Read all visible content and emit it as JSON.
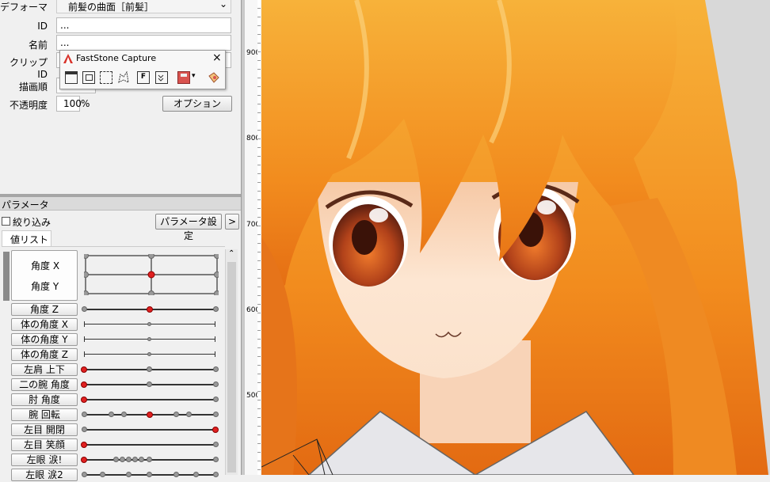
{
  "deformer": {
    "label": "デフォーマ",
    "value": "前髪の曲面［前髪］"
  },
  "id_field": {
    "label": "ID",
    "value": "..."
  },
  "name_field": {
    "label": "名前",
    "value": "..."
  },
  "clip_field": {
    "label": "クリップID"
  },
  "draw_order": {
    "label": "描画順"
  },
  "opacity": {
    "label": "不透明度",
    "value": "100",
    "unit": "%"
  },
  "option_button": "オプション",
  "faststone": {
    "title": "FastStone Capture",
    "close": "×"
  },
  "param_panel": {
    "title": "パラメータ",
    "filter_label": "絞り込み",
    "settings_button": "パラメータ設定",
    "more_button": ">",
    "tab": "値リスト"
  },
  "params": [
    {
      "label": "角度 X"
    },
    {
      "label": "角度 Y"
    },
    {
      "label": "角度 Z"
    },
    {
      "label": "体の角度 X"
    },
    {
      "label": "体の角度 Y"
    },
    {
      "label": "体の角度 Z"
    },
    {
      "label": "左肩 上下"
    },
    {
      "label": "二の腕 角度"
    },
    {
      "label": "肘 角度"
    },
    {
      "label": "腕 回転"
    },
    {
      "label": "左目 開閉"
    },
    {
      "label": "左目 笑顔"
    },
    {
      "label": "左眼 涙!"
    },
    {
      "label": "左眼 涙2"
    }
  ],
  "ruler": [
    "900",
    "800",
    "700",
    "600",
    "500"
  ],
  "colors": {
    "hair": "#f59a2a",
    "hair_dark": "#e06a10",
    "skin": "#fde6d2",
    "eye": "#a83a12",
    "active_key": "#e02020"
  }
}
